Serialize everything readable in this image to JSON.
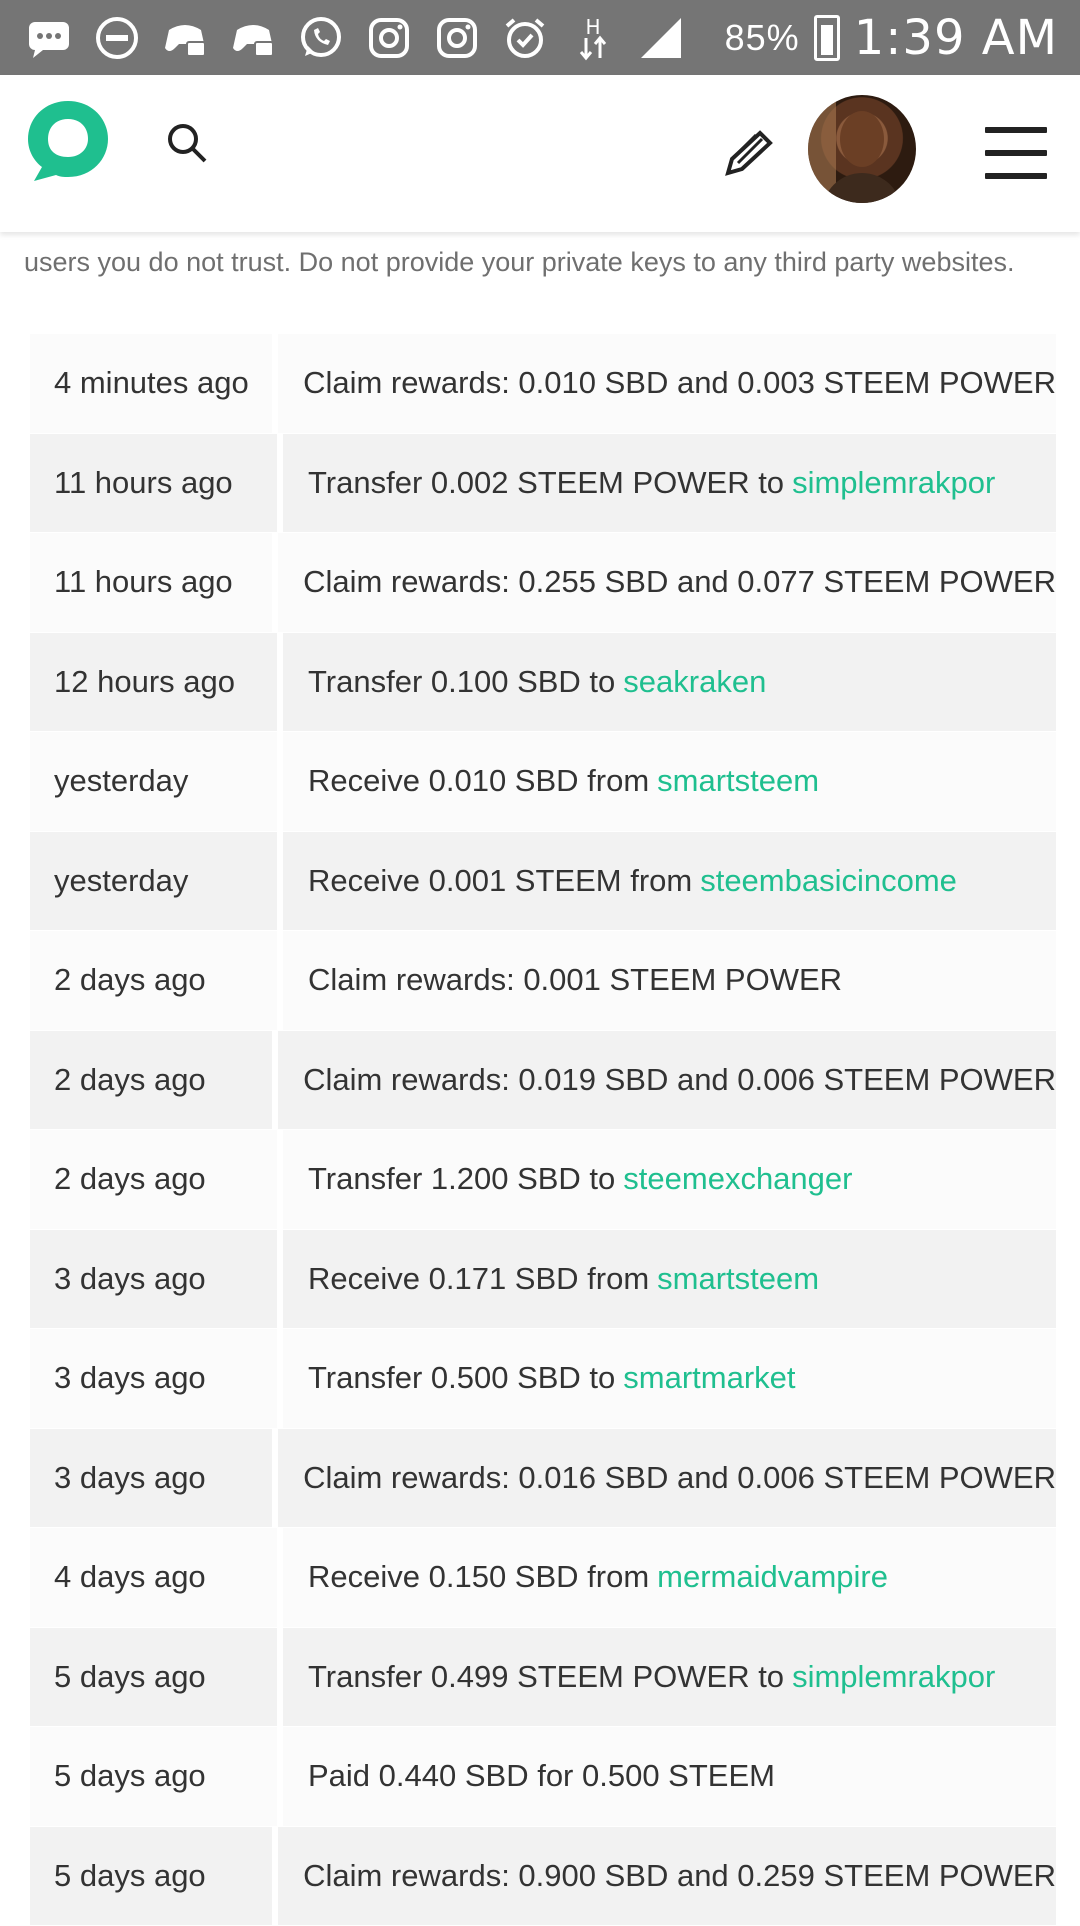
{
  "status_bar": {
    "icons": [
      "message-icon",
      "do-not-disturb-icon",
      "game-controller-icon",
      "game-controller-icon",
      "whatsapp-icon",
      "instagram-icon",
      "instagram-icon",
      "alarm-icon",
      "data-arrows-icon",
      "signal-icon"
    ],
    "data_letter": "H",
    "battery": "85%",
    "time": "1:39 AM"
  },
  "header": {
    "logo": "steemit-logo",
    "search_icon": "search-icon",
    "compose_icon": "pencil-icon",
    "avatar": "user-avatar",
    "menu_icon": "hamburger-menu-icon"
  },
  "notice": "users you do not trust. Do not provide your private keys to any third party websites.",
  "history": [
    {
      "time": "4 minutes ago",
      "text": "Claim rewards: 0.010 SBD and 0.003 STEEM POWER",
      "account": ""
    },
    {
      "time": "11 hours ago",
      "text": "Transfer 0.002 STEEM POWER to",
      "account": "simplemrakpor"
    },
    {
      "time": "11 hours ago",
      "text": "Claim rewards: 0.255 SBD and 0.077 STEEM POWER",
      "account": ""
    },
    {
      "time": "12 hours ago",
      "text": "Transfer 0.100 SBD to",
      "account": "seakraken"
    },
    {
      "time": "yesterday",
      "text": "Receive 0.010 SBD from",
      "account": "smartsteem"
    },
    {
      "time": "yesterday",
      "text": "Receive 0.001 STEEM from",
      "account": "steembasicincome"
    },
    {
      "time": "2 days ago",
      "text": "Claim rewards: 0.001 STEEM POWER",
      "account": ""
    },
    {
      "time": "2 days ago",
      "text": "Claim rewards: 0.019 SBD and 0.006 STEEM POWER",
      "account": ""
    },
    {
      "time": "2 days ago",
      "text": "Transfer 1.200 SBD to",
      "account": "steemexchanger"
    },
    {
      "time": "3 days ago",
      "text": "Receive 0.171 SBD from",
      "account": "smartsteem"
    },
    {
      "time": "3 days ago",
      "text": "Transfer 0.500 SBD to",
      "account": "smartmarket"
    },
    {
      "time": "3 days ago",
      "text": "Claim rewards: 0.016 SBD and 0.006 STEEM POWER",
      "account": ""
    },
    {
      "time": "4 days ago",
      "text": "Receive 0.150 SBD from",
      "account": "mermaidvampire"
    },
    {
      "time": "5 days ago",
      "text": "Transfer 0.499 STEEM POWER to",
      "account": "simplemrakpor"
    },
    {
      "time": "5 days ago",
      "text": "Paid 0.440 SBD for 0.500 STEEM",
      "account": ""
    },
    {
      "time": "5 days ago",
      "text": "Claim rewards: 0.900 SBD and 0.259 STEEM POWER",
      "account": ""
    }
  ],
  "colors": {
    "accent": "#1fbf8f",
    "status_bar": "#757575",
    "row_light": "#fbfbfb",
    "row_dark": "#f2f2f2"
  }
}
